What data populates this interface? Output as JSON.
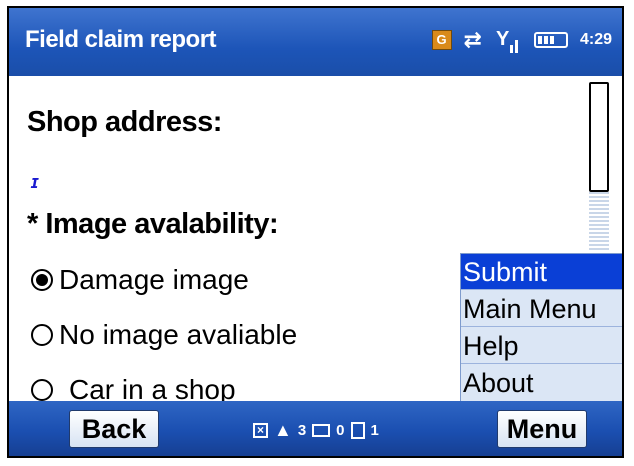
{
  "titlebar": {
    "title": "Field claim report",
    "network_letter": "G",
    "time": "4:29",
    "icons": [
      "network-g-icon",
      "data-transfer-icon",
      "signal-icon",
      "battery-icon"
    ]
  },
  "form": {
    "shop_address_label": "Shop address:",
    "shop_address_value": "",
    "image_availability_label": "* Image avalability:",
    "options": [
      {
        "label": "Damage image",
        "checked": true
      },
      {
        "label": "No image avaliable",
        "checked": false
      },
      {
        "label": "Car in a shop",
        "checked": false
      }
    ]
  },
  "popup_menu": {
    "items": [
      {
        "label": "Submit",
        "selected": true
      },
      {
        "label": "Main Menu",
        "selected": false
      },
      {
        "label": "Help",
        "selected": false
      },
      {
        "label": "About",
        "selected": false
      }
    ]
  },
  "softbar": {
    "left_label": "Back",
    "right_label": "Menu",
    "notifications": {
      "warning_count": "3",
      "mail_count": "0",
      "clipboard_count": "1"
    }
  },
  "colors": {
    "title_bar": "#1d55b8",
    "menu_selected": "#0a3fd6",
    "menu_bg": "#dbe6f5"
  }
}
